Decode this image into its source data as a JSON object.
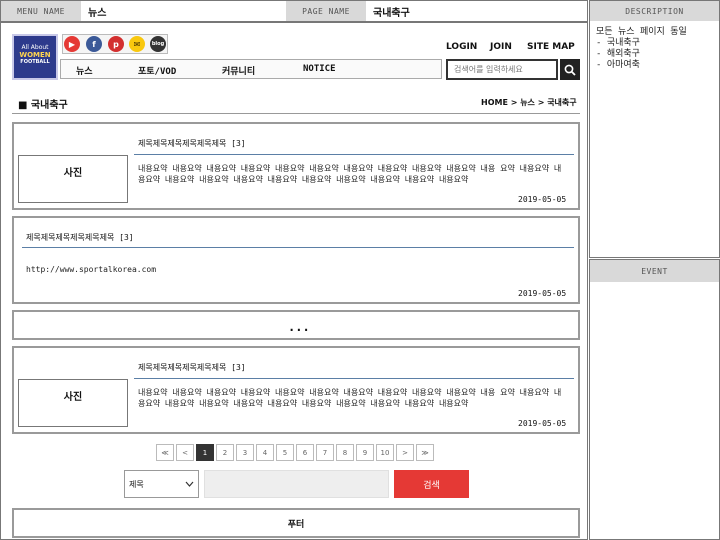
{
  "header": {
    "menu_name_label": "MENU NAME",
    "menu_name_value": "뉴스",
    "page_name_label": "PAGE NAME",
    "page_name_value": "국내축구"
  },
  "logo": {
    "line1": "All About",
    "line2": "WOMEN",
    "line3": "FOOTBALL"
  },
  "top_links": {
    "login": "LOGIN",
    "join": "JOIN",
    "sitemap": "SITE MAP"
  },
  "nav": {
    "items": [
      "뉴스",
      "포토/VOD",
      "커뮤니티",
      "NOTICE"
    ]
  },
  "search": {
    "placeholder": "검색어를 입력하세요"
  },
  "breadcrumb": {
    "section": "■ 국내축구",
    "path": "HOME > 뉴스 > 국내축구"
  },
  "articles": [
    {
      "title": "제목제목제목제목제목제목 [3]",
      "photo": "사진",
      "body": "내용요약 내용요약 내용요약 내용요약 내용요약 내용요약 내용요약 내용요약 내용요약 내용요약 내용 요약 내용요약 내용요약 내용요약 내용요약 내용요약 내용요약 내용요약 내용요약 내용요약 내용요약 내용요약",
      "date": "2019-05-05"
    },
    {
      "title": "제목제목제목제목제목제목 [3]",
      "url": "http://www.sportalkorea.com",
      "date": "2019-05-05"
    },
    {
      "title": "제목제목제목제목제목제목 [3]",
      "photo": "사진",
      "body": "내용요약 내용요약 내용요약 내용요약 내용요약 내용요약 내용요약 내용요약 내용요약 내용요약 내용 요약 내용요약 내용요약 내용요약 내용요약 내용요약 내용요약 내용요약 내용요약 내용요약 내용요약 내용요약",
      "date": "2019-05-05"
    }
  ],
  "ellipsis": "...",
  "pagination": {
    "first": "≪",
    "prev": "<",
    "pages": [
      "1",
      "2",
      "3",
      "4",
      "5",
      "6",
      "7",
      "8",
      "9",
      "10"
    ],
    "current": "1",
    "next": ">",
    "last": "≫"
  },
  "bottom_search": {
    "select_value": "제목",
    "button": "검색"
  },
  "footer": {
    "label": "푸터"
  },
  "sidebar": {
    "description_label": "DESCRIPTION",
    "description_lines": [
      "모든 뉴스 페이지 동일",
      "- 국내축구",
      "- 해외축구",
      "- 아마여축"
    ],
    "event_label": "EVENT"
  },
  "colors": {
    "accent_red": "#e53935",
    "rule_blue": "#5b7fa6",
    "logo_bg": "#2d3a8c"
  },
  "social_icons": [
    "youtube-icon",
    "facebook-icon",
    "pinterest-icon",
    "kakao-icon",
    "naver-blog-icon"
  ]
}
